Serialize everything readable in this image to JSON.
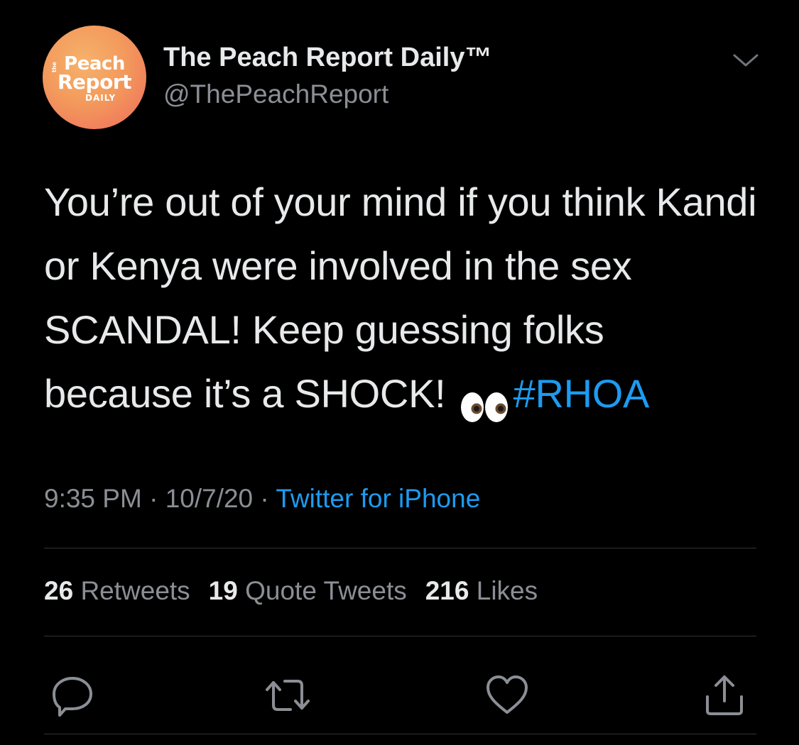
{
  "author": {
    "display_name": "The Peach Report Daily™",
    "handle": "@ThePeachReport",
    "avatar_logo": {
      "line_the": "the",
      "line1": "Peach",
      "line2": "Report",
      "line3": "DAILY"
    }
  },
  "tweet": {
    "text_before": "You’re out of your mind if you think Kandi or Kenya were involved in the sex SCANDAL! Keep guessing folks because it’s a SHOCK!",
    "emoji": "eyes",
    "hashtag": "#RHOA"
  },
  "meta": {
    "time": "9:35 PM",
    "separator1": " · ",
    "date": "10/7/20",
    "separator2": " · ",
    "source": "Twitter for iPhone"
  },
  "stats": {
    "retweets_count": "26",
    "retweets_label": "Retweets",
    "quotes_count": "19",
    "quotes_label": "Quote Tweets",
    "likes_count": "216",
    "likes_label": "Likes"
  },
  "actions": {
    "reply_icon": "reply-icon",
    "retweet_icon": "retweet-icon",
    "like_icon": "heart-icon",
    "share_icon": "share-icon"
  },
  "colors": {
    "background": "#000000",
    "text": "#e7e9ea",
    "secondary": "#8b8f95",
    "accent": "#1d9bf0",
    "divider": "#2f3336"
  }
}
